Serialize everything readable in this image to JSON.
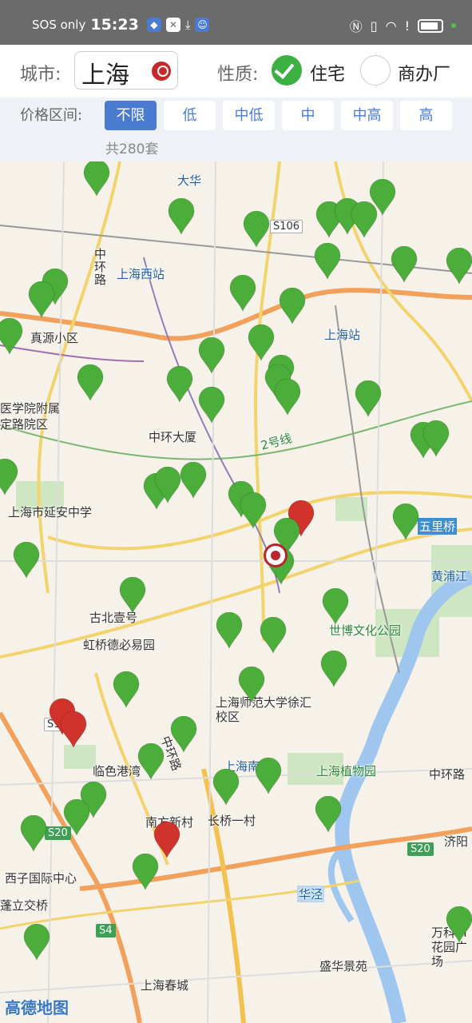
{
  "status_bar": {
    "carrier": "SOS only",
    "time": "15:23"
  },
  "filter": {
    "city_label": "城市:",
    "city_value": "上海",
    "type_label": "性质:",
    "options": [
      {
        "label": "住宅",
        "checked": true
      },
      {
        "label": "商办厂",
        "checked": false
      }
    ],
    "price_label": "价格区间:",
    "price_options": [
      "不限",
      "低",
      "中低",
      "中",
      "中高",
      "高"
    ],
    "price_selected": "不限",
    "count_text": "共280套"
  },
  "map": {
    "labels": [
      "大华",
      "上海西站",
      "中环路",
      "真源小区",
      "上海站",
      "医学院附属",
      "定路院区",
      "中环大厦",
      "2号线",
      "上海市延安中学",
      "五里桥",
      "古北壹号",
      "虹桥德必易园",
      "世博文化公园",
      "上海师范大学徐汇校区",
      "临色港湾",
      "中环路",
      "上海南",
      "上海植物园",
      "中环路",
      "南方新村",
      "长桥一村",
      "济阳",
      "西子国际中心",
      "华泾",
      "万科VI花园广场",
      "盛华景苑",
      "上海春城",
      "蓬立交桥",
      "黄浦江"
    ],
    "road_badges": [
      "S106",
      "S20",
      "S20",
      "S4",
      "S1"
    ],
    "logo": "高德地图",
    "marker_colors": {
      "green": "#4cae3a",
      "red": "#d0322c"
    }
  }
}
